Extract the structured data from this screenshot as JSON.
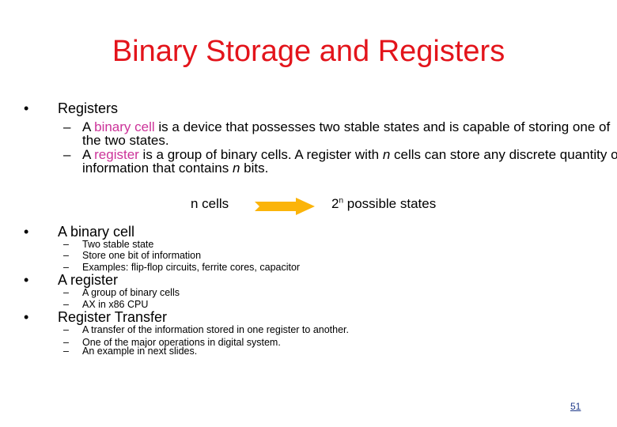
{
  "slide": {
    "title": "Binary Storage and Registers",
    "bullet_glyph": "•",
    "dash_glyph": "–",
    "sections": [
      {
        "heading": "Registers",
        "items": [
          {
            "pre": "A ",
            "highlight": "binary cell",
            "post_line1": " is a device that possesses two stable states and is capable of storing one of",
            "line2": "the two states."
          },
          {
            "pre": "A ",
            "highlight": "register",
            "post_a": " is a group of binary cells. A register with ",
            "italic_n": "n",
            "post_b": " cells can store any discrete quantity of",
            "line2_a": "information that contains ",
            "line2_italic": "n",
            "line2_b": " bits."
          }
        ]
      },
      {
        "heading": "A binary cell",
        "items": [
          "Two stable state",
          "Store one bit of information",
          "Examples: flip-flop circuits, ferrite cores, capacitor"
        ]
      },
      {
        "heading": "A register",
        "items": [
          "A group of binary cells",
          "AX in x86 CPU"
        ]
      },
      {
        "heading": "Register Transfer",
        "items": [
          "A transfer of the information stored in one register to another.",
          "One of the major operations in digital system.",
          "An example in next slides."
        ]
      }
    ],
    "diagram": {
      "left_label": "n cells",
      "right_base": "2",
      "right_sup": "n",
      "right_rest": " possible states",
      "arrow_color": "#fbb40a"
    },
    "page_number": "51",
    "colors": {
      "title": "#e3141b",
      "highlight": "#cc3399"
    }
  }
}
